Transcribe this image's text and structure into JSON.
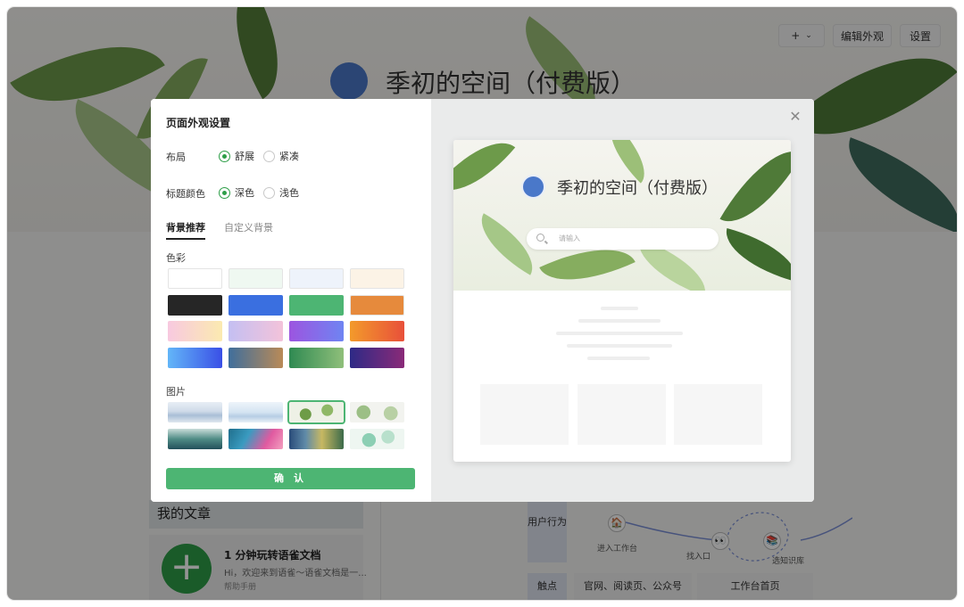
{
  "background_page": {
    "toolbar": {
      "plus_label": "+",
      "appearance_label": "编辑外观",
      "settings_label": "设置"
    },
    "space_title": "季初的空间（付费版）",
    "my_articles": {
      "header": "我的文章",
      "card": {
        "title": "1 分钟玩转语雀文档",
        "description": "Hi，欢迎来到语雀～语雀文档是一...",
        "tag": "帮助手册"
      }
    },
    "journey": {
      "row1_label": "用户行为",
      "row2_label": "触点",
      "nodes": [
        "进入工作台",
        "找入口",
        "选知识库"
      ],
      "cells": [
        "官网、阅读页、公众号",
        "工作台首页"
      ]
    }
  },
  "modal": {
    "title": "页面外观设置",
    "layout": {
      "label": "布局",
      "options": [
        "舒展",
        "紧凑"
      ],
      "selected": "舒展"
    },
    "title_color": {
      "label": "标题颜色",
      "options": [
        "深色",
        "浅色"
      ],
      "selected": "深色"
    },
    "tabs": [
      "背景推荐",
      "自定义背景"
    ],
    "active_tab": "背景推荐",
    "colors_label": "色彩",
    "images_label": "图片",
    "confirm_label": "确 认",
    "swatch_colors": {
      "solid": [
        "#ffffff",
        "#eff8f1",
        "#eef3fb",
        "#fcf3e6",
        "#262626",
        "#3a6fe0",
        "#4db573",
        "#e68a3c"
      ],
      "gradients": [
        [
          "#f8c9e0",
          "#fbeab0"
        ],
        [
          "#c4bff2",
          "#f3c3da"
        ],
        [
          "#9c55e0",
          "#6f84f2"
        ],
        [
          "#f39a2b",
          "#e8503a"
        ],
        [
          "#63b6f8",
          "#3a4fe6"
        ],
        [
          "#3f6e9c",
          "#b98a57"
        ],
        [
          "#2f8a52",
          "#8fbf7a"
        ],
        [
          "#2e2a86",
          "#8a2a78"
        ]
      ]
    },
    "image_thumbs": [
      "mountains-blue",
      "mountains-light",
      "leaves-green",
      "leaves-white",
      "mountains-teal",
      "aurora-pink",
      "forest-painting",
      "leaves-mint"
    ],
    "selected_image": "leaves-green",
    "preview": {
      "title": "季初的空间（付费版）",
      "search_placeholder": "请输入"
    }
  }
}
